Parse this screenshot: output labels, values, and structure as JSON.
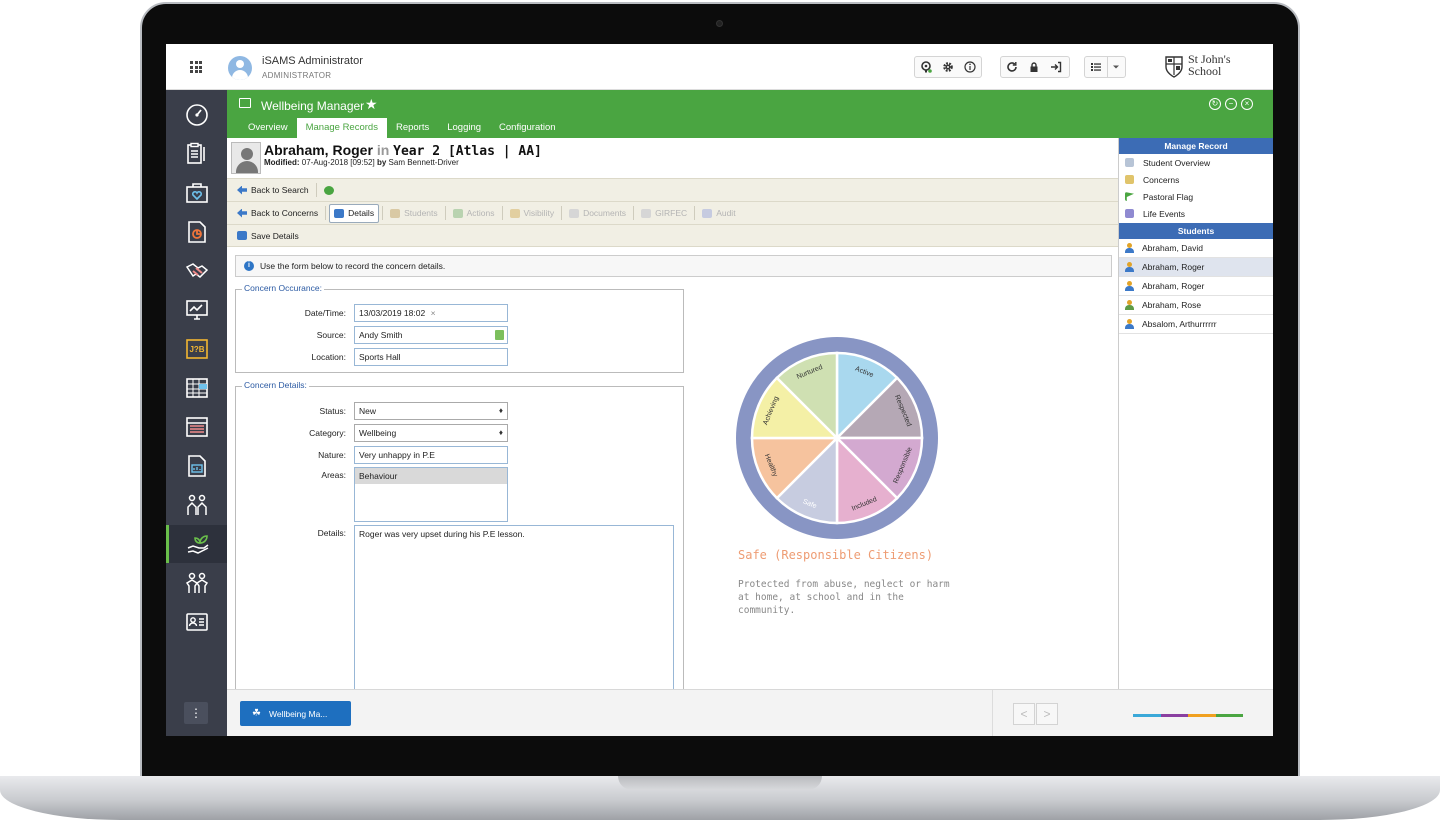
{
  "header": {
    "user_name": "iSAMS Administrator",
    "user_role": "ADMINISTRATOR",
    "school_line1": "St John's",
    "school_line2": "School"
  },
  "leftnav": {
    "items": [
      "dashboard-icon",
      "clipboard-icon",
      "medical-kit-icon",
      "report-chart-icon",
      "handshake-icon",
      "monitor-chart-icon",
      "job-icon",
      "calendar-grid-icon",
      "timetable-icon",
      "document-chart-icon",
      "people-icon",
      "wellbeing-hand-icon",
      "pupils-icon",
      "id-card-icon"
    ],
    "active": "wellbeing-hand-icon"
  },
  "module": {
    "title": "Wellbeing Manager",
    "tabs": [
      "Overview",
      "Manage Records",
      "Reports",
      "Logging",
      "Configuration"
    ],
    "active_tab": "Manage Records"
  },
  "student": {
    "name": "Abraham, Roger",
    "in_word": "in",
    "group": "Year 2 [Atlas | AA]",
    "modified_label": "Modified:",
    "modified_date": "07-Aug-2018 [09:52]",
    "by_word": "by",
    "modified_by": "Sam Bennett-Driver"
  },
  "toolbar": {
    "back_to_search": "Back to Search",
    "back_to_concerns": "Back to Concerns",
    "tabs": [
      "Details",
      "Students",
      "Actions",
      "Visibility",
      "Documents",
      "GIRFEC",
      "Audit"
    ],
    "save_details": "Save Details"
  },
  "info_text": "Use the form below to record the concern details.",
  "occurrence": {
    "legend": "Concern Occurance:",
    "datetime_label": "Date/Time:",
    "datetime_value": "13/03/2019 18:02",
    "clear_symbol": "×",
    "source_label": "Source:",
    "source_value": "Andy Smith",
    "location_label": "Location:",
    "location_value": "Sports Hall"
  },
  "details": {
    "legend": "Concern Details:",
    "status_label": "Status:",
    "status_value": "New",
    "category_label": "Category:",
    "category_value": "Wellbeing",
    "nature_label": "Nature:",
    "nature_value": "Very unhappy in P.E",
    "areas_label": "Areas:",
    "areas_selected": "Behaviour",
    "details_label": "Details:",
    "details_value": "Roger was very upset during his P.E lesson."
  },
  "wheel": {
    "segments": [
      {
        "label": "Active",
        "color": "#a9d8ee"
      },
      {
        "label": "Respected",
        "color": "#b5a8b5"
      },
      {
        "label": "Responsible",
        "color": "#d3a9d0"
      },
      {
        "label": "Included",
        "color": "#e6b0cf"
      },
      {
        "label": "Safe",
        "color": "#c7cce0"
      },
      {
        "label": "Healthy",
        "color": "#f6c39e"
      },
      {
        "label": "Achieving",
        "color": "#f4f0a6"
      },
      {
        "label": "Nurtured",
        "color": "#cfe0b2"
      }
    ],
    "ring_color": "#8895c4",
    "selected": "Safe",
    "caption": "Safe (Responsible Citizens)",
    "description": "Protected from abuse, neglect or harm at home, at school and in the community."
  },
  "rightpanel": {
    "manage_header": "Manage Record",
    "manage_items": [
      "Student Overview",
      "Concerns",
      "Pastoral Flag",
      "Life Events"
    ],
    "students_header": "Students",
    "students": [
      "Abraham, David",
      "Abraham, Roger",
      "Abraham, Roger",
      "Abraham, Rose",
      "Absalom, Arthurrrrrr"
    ],
    "selected_index": 1
  },
  "footer": {
    "taskbar_label": "Wellbeing Ma...",
    "prev": "<",
    "next": ">",
    "colorbar": [
      "#3aa8d8",
      "#8a3fa0",
      "#f0a020",
      "#4aa541"
    ]
  },
  "colors": {
    "accent_green": "#4aa541",
    "nav_bg": "#3a3e4a",
    "panel_blue": "#3c6cb5"
  }
}
